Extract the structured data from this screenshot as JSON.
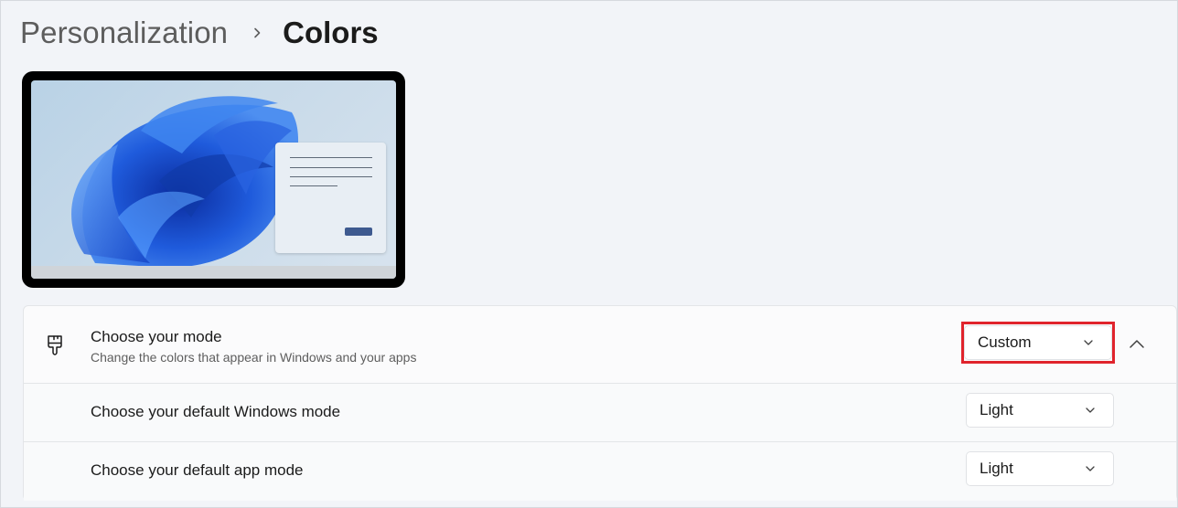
{
  "breadcrumb": {
    "parent": "Personalization",
    "current": "Colors"
  },
  "icons": {
    "separator": "chevron-right-icon",
    "mode_icon": "paintbrush-icon",
    "dropdown": "chevron-down-icon",
    "collapse": "chevron-up-icon"
  },
  "colors": {
    "highlight": "#e0242c",
    "bloom": "#1f5bdc"
  },
  "mode_section": {
    "title": "Choose your mode",
    "description": "Change the colors that appear in Windows and your apps",
    "selected": "Custom",
    "expanded": true
  },
  "windows_mode": {
    "label": "Choose your default Windows mode",
    "selected": "Light"
  },
  "app_mode": {
    "label": "Choose your default app mode",
    "selected": "Light"
  }
}
